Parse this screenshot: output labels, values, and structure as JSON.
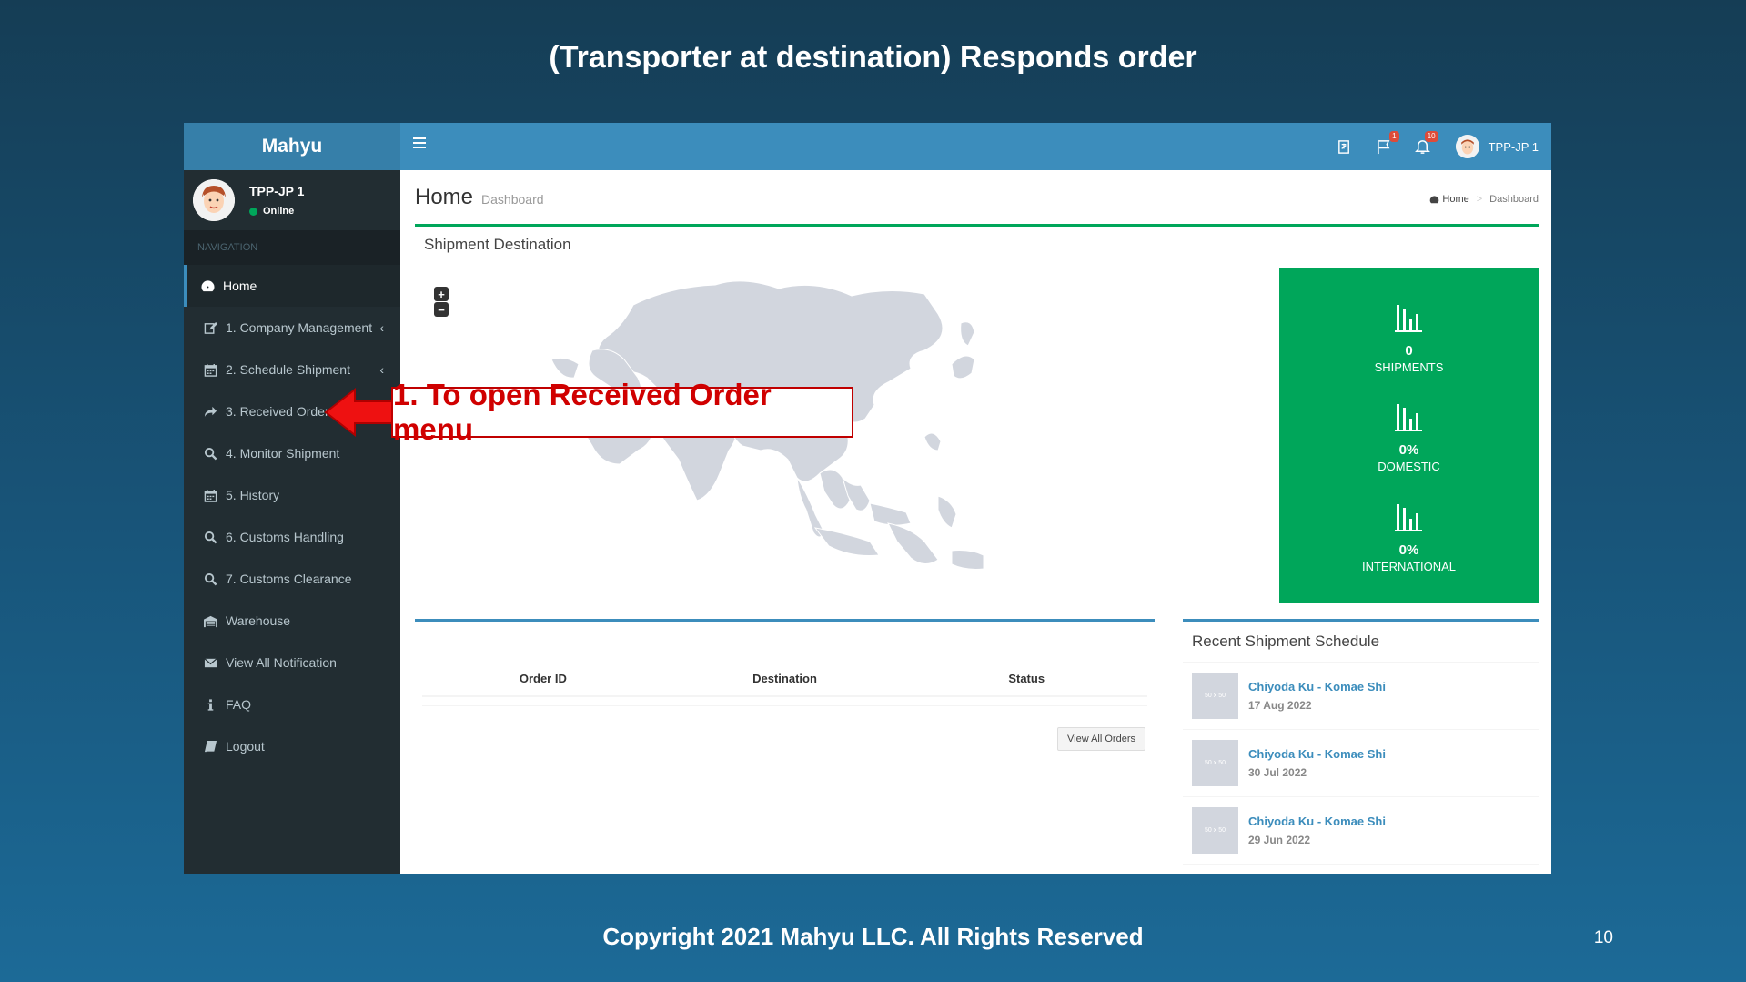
{
  "slide": {
    "title": "(Transporter at destination) Responds order",
    "footer": "Copyright 2021 Mahyu LLC. All Rights Reserved",
    "page_number": "10"
  },
  "app": {
    "brand": "Mahyu",
    "user": {
      "name": "TPP-JP 1",
      "status": "Online"
    },
    "nav_header": "NAVIGATION",
    "nav": [
      {
        "label": "Home",
        "icon": "dashboard-icon",
        "active": true
      },
      {
        "label": "1. Company Management",
        "icon": "edit-icon",
        "has_chevron": true
      },
      {
        "label": "2. Schedule Shipment",
        "icon": "calendar-icon",
        "has_chevron": true
      },
      {
        "label": "3. Received Order",
        "icon": "share-icon"
      },
      {
        "label": "4. Monitor Shipment",
        "icon": "search-icon"
      },
      {
        "label": "5. History",
        "icon": "calendar-icon"
      },
      {
        "label": "6. Customs Handling",
        "icon": "search-icon"
      },
      {
        "label": "7. Customs Clearance",
        "icon": "search-icon"
      },
      {
        "label": "Warehouse",
        "icon": "warehouse-icon"
      },
      {
        "label": "View All Notification",
        "icon": "envelope-icon"
      },
      {
        "label": "FAQ",
        "icon": "info-icon"
      },
      {
        "label": "Logout",
        "icon": "book-icon"
      }
    ],
    "topbar": {
      "flag_badge": "1",
      "bell_badge": "10",
      "user_name": "TPP-JP 1",
      "chevron": "‹"
    },
    "content": {
      "title": "Home",
      "subtitle": "Dashboard",
      "breadcrumb": {
        "home": "Home",
        "current": "Dashboard"
      },
      "map_box_title": "Shipment Destination",
      "zoom_in": "+",
      "zoom_out": "−",
      "stats": [
        {
          "value": "0",
          "label": "SHIPMENTS"
        },
        {
          "value": "0%",
          "label": "DOMESTIC"
        },
        {
          "value": "0%",
          "label": "INTERNATIONAL"
        }
      ],
      "orders": {
        "columns": [
          "Order ID",
          "Destination",
          "Status"
        ],
        "view_all": "View All Orders"
      },
      "recent": {
        "title": "Recent Shipment Schedule",
        "thumb_text": "50 x 50",
        "items": [
          {
            "route": "Chiyoda Ku - Komae Shi",
            "date": "17 Aug 2022"
          },
          {
            "route": "Chiyoda Ku - Komae Shi",
            "date": "30 Jul 2022"
          },
          {
            "route": "Chiyoda Ku - Komae Shi",
            "date": "29 Jun 2022"
          }
        ]
      }
    }
  },
  "annotation": {
    "text": "1. To open Received Order menu",
    "color": "#d00000"
  },
  "colors": {
    "sidebar": "#222d32",
    "topbar": "#3c8dbc",
    "brand": "#367fa9",
    "stats": "#00a65a"
  }
}
